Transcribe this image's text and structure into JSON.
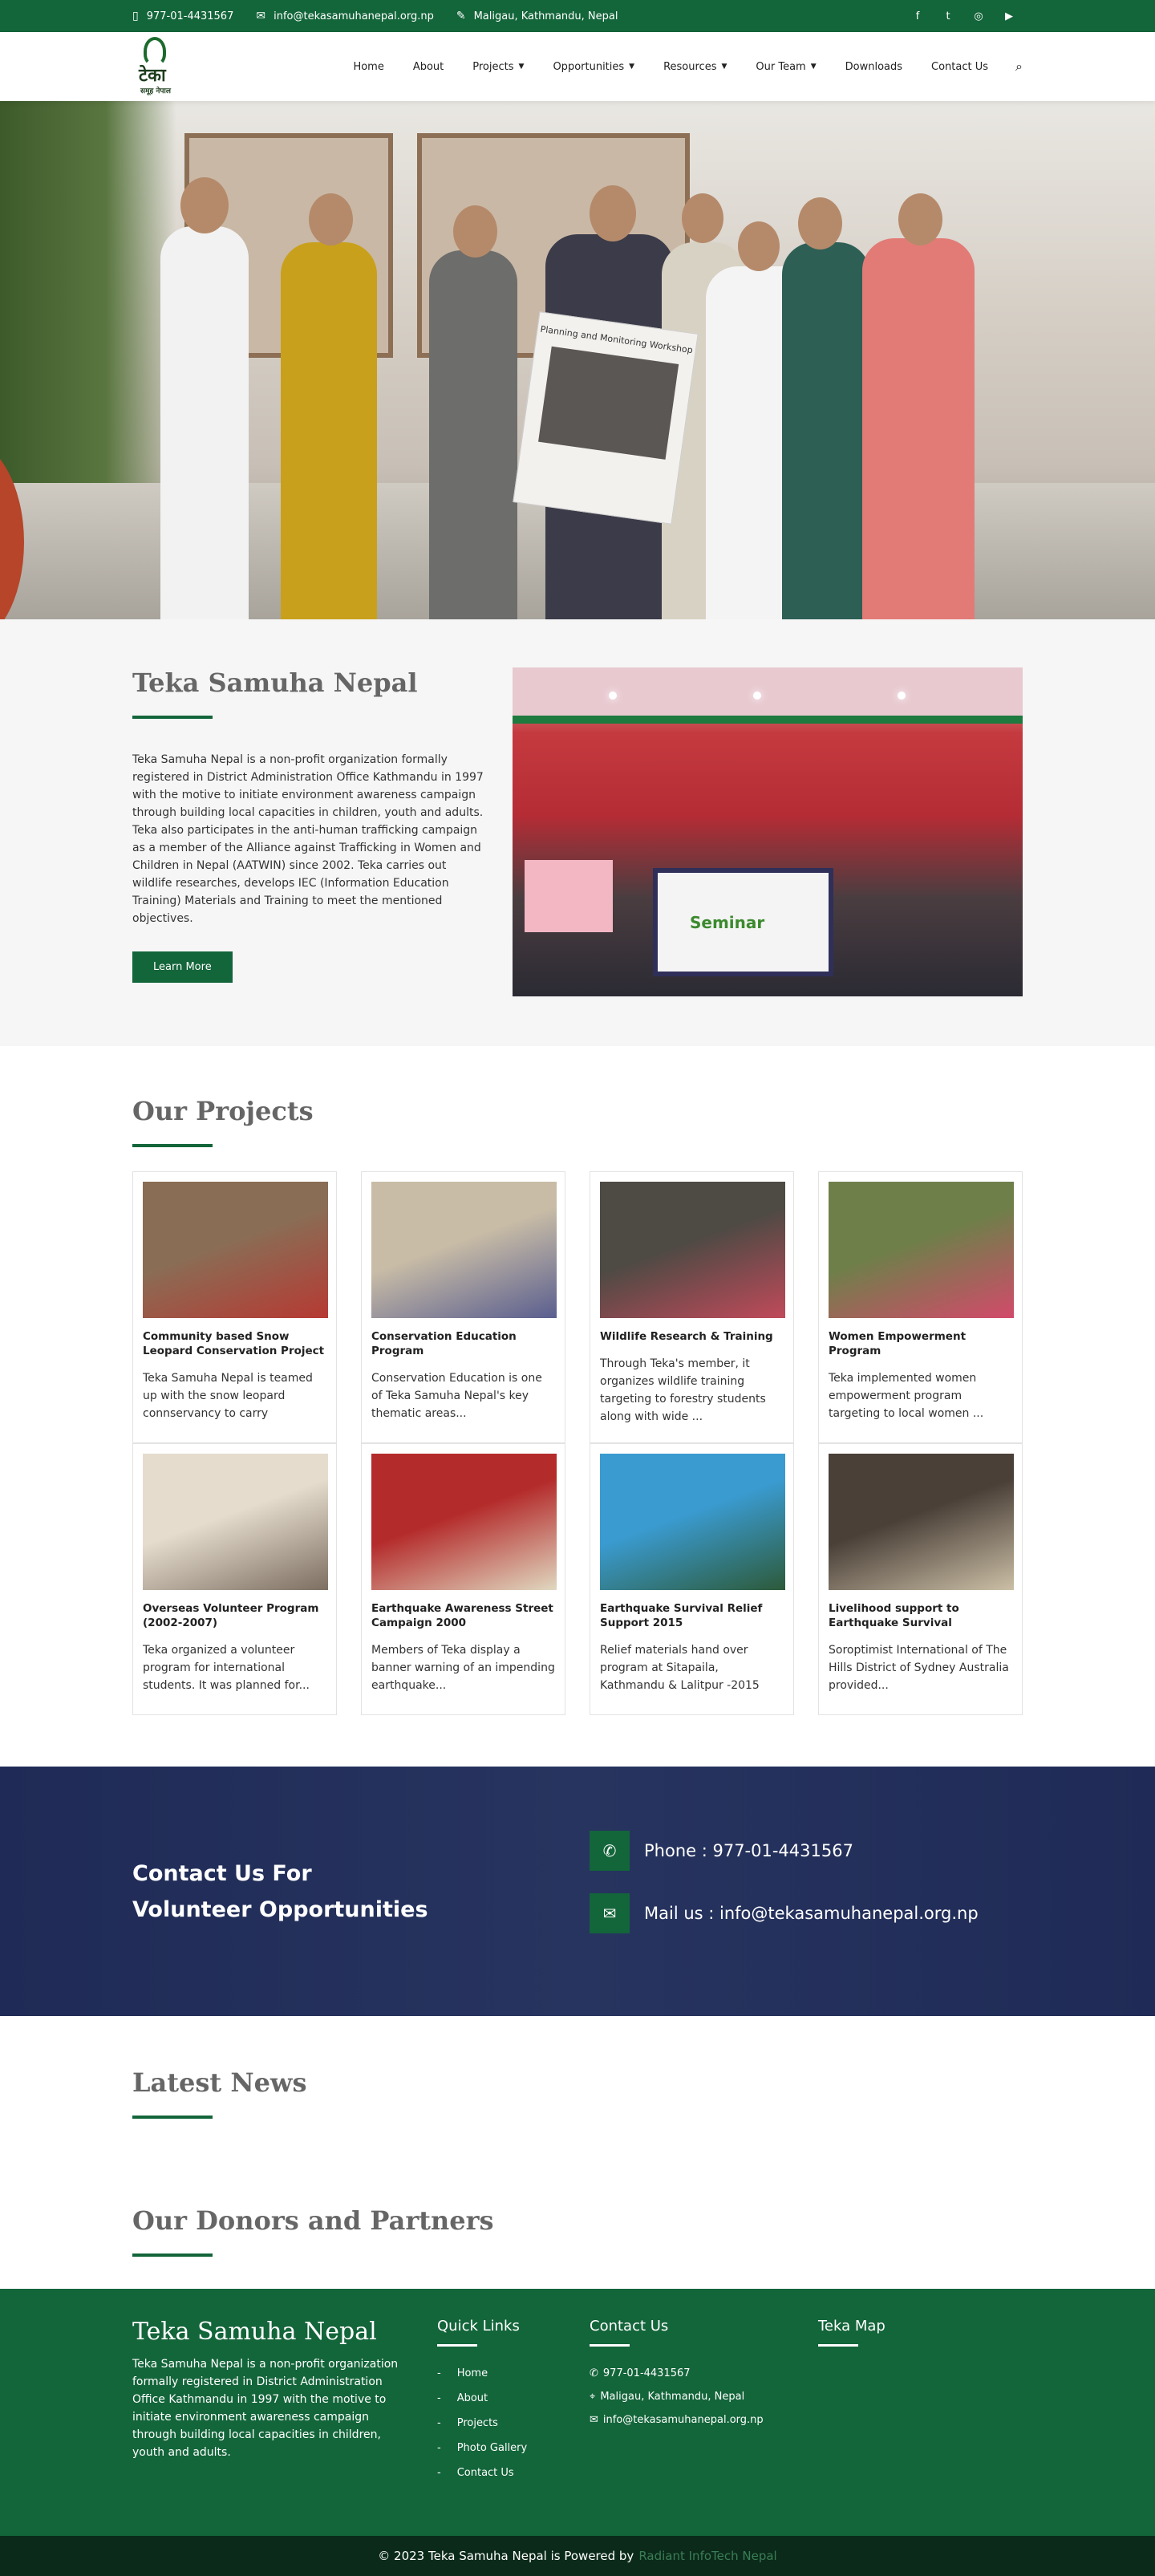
{
  "topbar": {
    "phone": "977-01-4431567",
    "email": "info@tekasamuhanepal.org.np",
    "address": "Maligau, Kathmandu, Nepal",
    "social": [
      "f",
      "t",
      "◎",
      "▶"
    ]
  },
  "brand": {
    "logo_text": "टेका",
    "logo_sub": "समूह नेपाल"
  },
  "nav": [
    {
      "label": "Home"
    },
    {
      "label": "About"
    },
    {
      "label": "Projects",
      "dropdown": true
    },
    {
      "label": "Opportunities",
      "dropdown": true
    },
    {
      "label": "Resources",
      "dropdown": true
    },
    {
      "label": "Our Team",
      "dropdown": true
    },
    {
      "label": "Downloads"
    },
    {
      "label": "Contact Us"
    }
  ],
  "hero": {
    "banner_text": "Planning and Monitoring Workshop"
  },
  "about": {
    "title": "Teka Samuha Nepal",
    "text": "Teka Samuha Nepal is a non-profit organization formally registered in District Administration Office Kathmandu in 1997 with the motive to initiate environment awareness campaign through building local capacities in children, youth and adults. Teka also participates in the anti-human trafficking campaign as a member of the Alliance against Trafficking in Women and Children in Nepal (AATWIN) since 2002. Teka carries out wildlife researches, develops IEC (Information Education Training) Materials and Training to meet the mentioned objectives.",
    "button": "Learn More",
    "image_banner": "Seminar"
  },
  "projects": {
    "title": "Our Projects",
    "items": [
      {
        "title": "Community based Snow Leopard Conservation Project",
        "desc": "Teka Samuha Nepal is teamed up with the snow leopard connservancy to carry",
        "c1": "#8a6d55",
        "c2": "#b63a33"
      },
      {
        "title": "Conservation Education Program",
        "desc": "Conservation Education is one of Teka Samuha Nepal's key thematic areas...",
        "c1": "#c8bca6",
        "c2": "#5a5e8f"
      },
      {
        "title": "Wildlife Research & Training",
        "desc": "Through Teka's member, it organizes wildlife training targeting to forestry students along with wide ...",
        "c1": "#4e4a44",
        "c2": "#c04a5a"
      },
      {
        "title": "Women Empowerment Program",
        "desc": "Teka implemented women empowerment program targeting to local women ...",
        "c1": "#6f7f4a",
        "c2": "#d24a6a"
      },
      {
        "title": "Overseas Volunteer Program (2002-2007)",
        "desc": "Teka organized a volunteer program for international students. It was planned for...",
        "c1": "#e5dccd",
        "c2": "#7d6f62"
      },
      {
        "title": "Earthquake Awareness Street Campaign 2000",
        "desc": "Members of Teka display a banner warning of an impending earthquake...",
        "c1": "#b42b2b",
        "c2": "#e0d8c0"
      },
      {
        "title": "Earthquake Survival Relief Support 2015",
        "desc": "Relief materials hand over program at Sitapaila, Kathmandu & Lalitpur -2015",
        "c1": "#3a9bd0",
        "c2": "#2d5a3a"
      },
      {
        "title": "Livelihood support to Earthquake Survival",
        "desc": "Soroptimist International of The Hills District of Sydney Australia provided...",
        "c1": "#4a4038",
        "c2": "#cbbfa6"
      }
    ]
  },
  "contact_band": {
    "title_line1": "Contact Us For",
    "title_line2": "Volunteer Opportunities",
    "phone": "Phone : 977-01-4431567",
    "mail": "Mail us : info@tekasamuhanepal.org.np"
  },
  "news": {
    "title": "Latest News"
  },
  "donors": {
    "title": "Our Donors and Partners"
  },
  "footer": {
    "brand": "Teka Samuha Nepal",
    "about": "Teka Samuha Nepal is a non-profit organization formally registered in District Administration Office Kathmandu in 1997 with the motive to initiate environment awareness campaign through building local capacities in children, youth and adults.",
    "quick_links_title": "Quick Links",
    "quick_links": [
      "Home",
      "About",
      "Projects",
      "Photo Gallery",
      "Contact Us"
    ],
    "contact_title": "Contact Us",
    "contact_phone": "977-01-4431567",
    "contact_address": "Maligau, Kathmandu, Nepal",
    "contact_email": "info@tekasamuhanepal.org.np",
    "map_title": "Teka Map",
    "copyright": "© 2023 Teka Samuha Nepal is Powered by",
    "powered_by": "Radiant InfoTech Nepal"
  },
  "colors": {
    "brand_green": "#13653a",
    "band_navy": "#1f2b56",
    "footer_dark": "#0b2a1a"
  }
}
